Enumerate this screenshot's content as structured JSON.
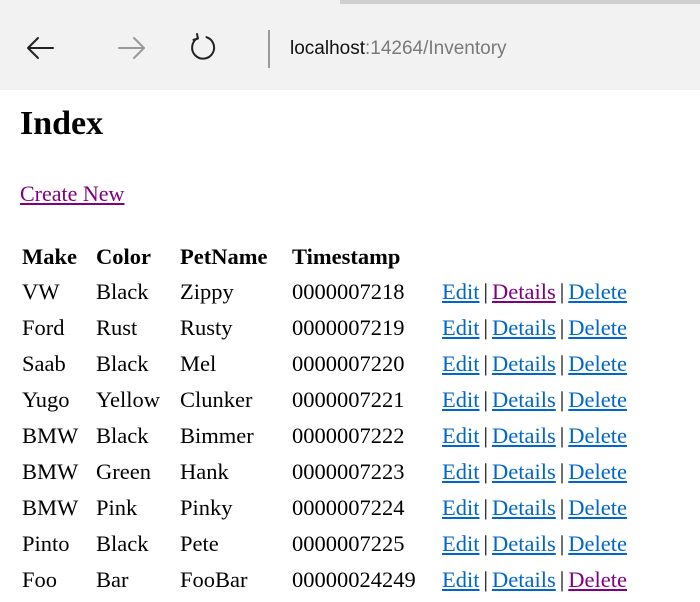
{
  "browser": {
    "url_host": "localhost",
    "url_path": ":14264/Inventory",
    "back_icon": "arrow-left-icon",
    "forward_icon": "arrow-right-icon",
    "refresh_icon": "refresh-icon"
  },
  "page": {
    "title": "Index",
    "create_link": "Create New",
    "link_color": "#0066cc",
    "visited_link_color": "#800080"
  },
  "table": {
    "headers": {
      "make": "Make",
      "color": "Color",
      "petname": "PetName",
      "timestamp": "Timestamp"
    },
    "actions": {
      "edit": "Edit",
      "details": "Details",
      "delete": "Delete",
      "separator": "|"
    },
    "rows": [
      {
        "make": "VW",
        "color": "Black",
        "petname": "Zippy",
        "timestamp": "0000007218",
        "visited": "details"
      },
      {
        "make": "Ford",
        "color": "Rust",
        "petname": "Rusty",
        "timestamp": "0000007219",
        "visited": ""
      },
      {
        "make": "Saab",
        "color": "Black",
        "petname": "Mel",
        "timestamp": "0000007220",
        "visited": ""
      },
      {
        "make": "Yugo",
        "color": "Yellow",
        "petname": "Clunker",
        "timestamp": "0000007221",
        "visited": ""
      },
      {
        "make": "BMW",
        "color": "Black",
        "petname": "Bimmer",
        "timestamp": "0000007222",
        "visited": ""
      },
      {
        "make": "BMW",
        "color": "Green",
        "petname": "Hank",
        "timestamp": "0000007223",
        "visited": ""
      },
      {
        "make": "BMW",
        "color": "Pink",
        "petname": "Pinky",
        "timestamp": "0000007224",
        "visited": ""
      },
      {
        "make": "Pinto",
        "color": "Black",
        "petname": "Pete",
        "timestamp": "0000007225",
        "visited": ""
      },
      {
        "make": "Foo",
        "color": "Bar",
        "petname": "FooBar",
        "timestamp": "00000024249",
        "visited": "delete"
      }
    ]
  }
}
